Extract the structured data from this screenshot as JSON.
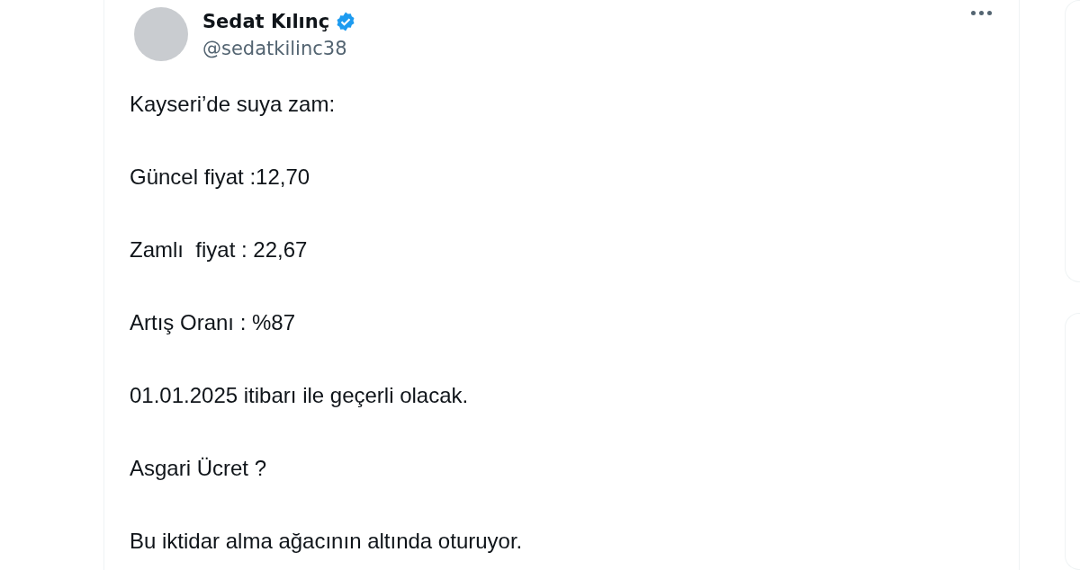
{
  "post": {
    "author": {
      "name": "Sedat Kılınç",
      "verified": true,
      "handle": "@sedatkilinc38"
    },
    "paragraphs": [
      "Kayseri’de suya zam:",
      "Güncel fiyat :12,70",
      "Zamlı  fiyat : 22,67",
      "Artış Oranı : %87",
      "01.01.2025 itibarı ile geçerli olacak.",
      "Asgari Ücret ?",
      "Bu iktidar alma ağacının altında oturuyor."
    ]
  }
}
